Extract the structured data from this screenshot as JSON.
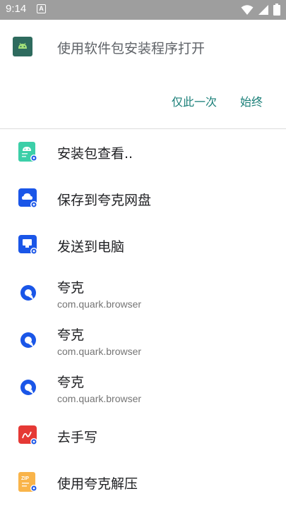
{
  "status_bar": {
    "time": "9:14",
    "notification_letter": "A"
  },
  "dialog": {
    "title": "使用软件包安装程序打开",
    "buttons": {
      "once": "仅此一次",
      "always": "始终"
    }
  },
  "items": [
    {
      "title": "安装包查看..",
      "icon": "android-package-icon"
    },
    {
      "title": "保存到夸克网盘",
      "icon": "quark-cloud-icon"
    },
    {
      "title": "发送到电脑",
      "icon": "send-to-pc-icon"
    },
    {
      "title": "夸克",
      "subtitle": "com.quark.browser",
      "icon": "quark-icon"
    },
    {
      "title": "夸克",
      "subtitle": "com.quark.browser",
      "icon": "quark-icon"
    },
    {
      "title": "夸克",
      "subtitle": "com.quark.browser",
      "icon": "quark-icon"
    },
    {
      "title": "去手写",
      "icon": "handwriting-icon"
    },
    {
      "title": "使用夸克解压",
      "icon": "zip-icon"
    }
  ],
  "colors": {
    "status_bar": "#9e9e9e",
    "accent": "#1a7f78",
    "quark_blue": "#1a56e8",
    "handwrite_red": "#e53935",
    "zip_yellow": "#f9b44a",
    "package_teal": "#3ccfa8"
  }
}
